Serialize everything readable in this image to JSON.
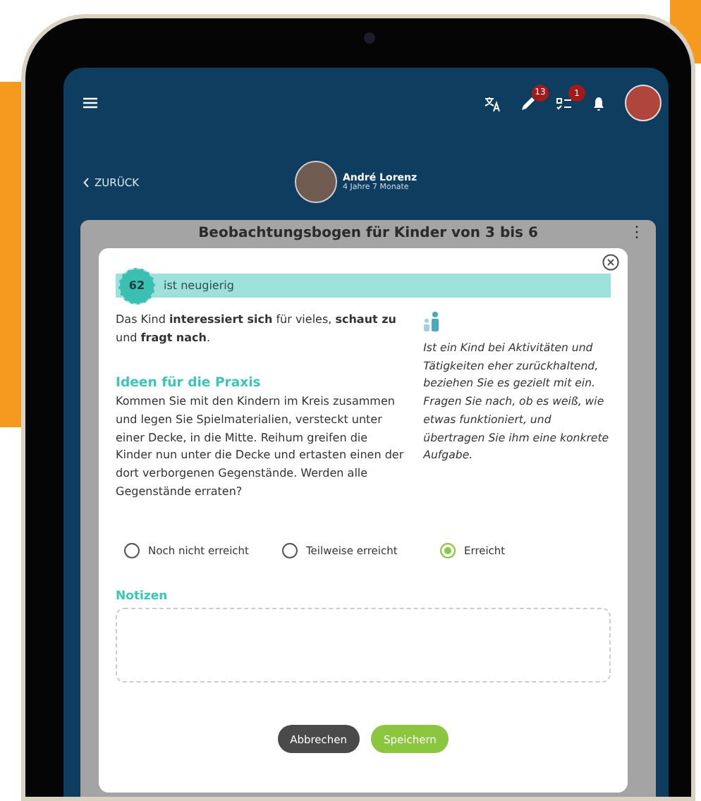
{
  "topbar": {
    "badges": [
      {
        "count": "13"
      },
      {
        "count": "1"
      }
    ]
  },
  "child": {
    "back": "ZURÜCK",
    "name": "André Lorenz",
    "age": "4 Jahre 7 Monate"
  },
  "card": {
    "title": "Beobachtungsbogen für Kinder von 3 bis 6",
    "menu": "⋮"
  },
  "modal": {
    "number": "62",
    "label": "ist neugierig",
    "description": "Das Kind **interessiert sich** für vieles, **schaut zu** und **fragt nach**.",
    "ideas_heading": "Ideen für die Praxis",
    "ideas": "Kommen Sie mit den Kindern im Kreis zusammen und legen Sie Spielmaterialien, versteckt unter einer Decke, in die Mitte. Reihum greifen die Kinder nun unter die Decke und ertasten einen der dort verborgenen Gegenstände. Werden alle Gegenstände erraten?",
    "tip": "Ist ein Kind bei Aktivitäten und Tätigkeiten eher zurückhaltend, beziehen Sie es gezielt mit ein. Fragen Sie nach, ob es weiß, wie etwas funktioniert, und übertragen Sie ihm eine konkrete Aufgabe.",
    "options": [
      {
        "label": "Noch nicht erreicht",
        "selected": false
      },
      {
        "label": "Teilweise erreicht",
        "selected": false
      },
      {
        "label": "Erreicht",
        "selected": true
      }
    ],
    "notes_label": "Notizen",
    "buttons": [
      {
        "kind": "cancel",
        "label": "Abbrechen"
      },
      {
        "kind": "save",
        "label": "Speichern"
      }
    ]
  }
}
